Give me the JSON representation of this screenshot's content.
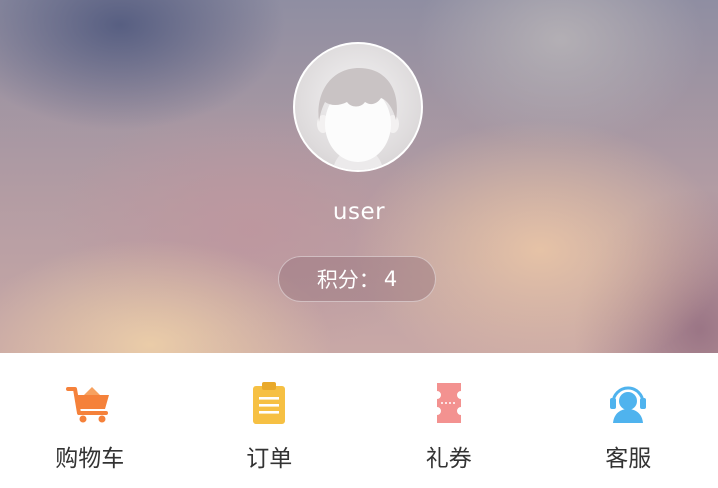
{
  "profile": {
    "username": "user",
    "points_label": "积分：",
    "points_value": "4",
    "avatar_icon": "default-avatar-icon"
  },
  "nav": {
    "items": [
      {
        "label": "购物车",
        "icon": "cart-icon",
        "color": "#f5813a"
      },
      {
        "label": "订单",
        "icon": "clipboard-icon",
        "color": "#f6c043"
      },
      {
        "label": "礼券",
        "icon": "ticket-icon",
        "color": "#f39290"
      },
      {
        "label": "客服",
        "icon": "headset-icon",
        "color": "#4fb3ee"
      }
    ]
  }
}
